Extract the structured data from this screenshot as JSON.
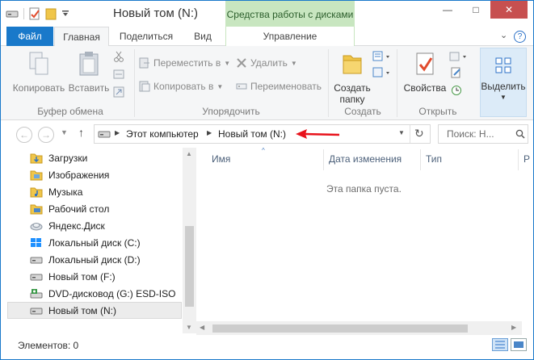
{
  "window": {
    "title": "Новый том (N:)",
    "context_tab_group": "Средства работы с дисками",
    "controls": {
      "minimize": "—",
      "maximize": "□",
      "close": "✕"
    }
  },
  "tabs": {
    "file": "Файл",
    "home": "Главная",
    "share": "Поделиться",
    "view": "Вид",
    "manage": "Управление"
  },
  "ribbon": {
    "clipboard": {
      "copy": "Копировать",
      "paste": "Вставить",
      "label": "Буфер обмена"
    },
    "organize": {
      "move_to": "Переместить в",
      "copy_to": "Копировать в",
      "delete": "Удалить",
      "rename": "Переименовать",
      "label": "Упорядочить"
    },
    "new": {
      "new_folder_line1": "Создать",
      "new_folder_line2": "папку",
      "label": "Создать"
    },
    "open": {
      "properties": "Свойства",
      "label": "Открыть"
    },
    "select": {
      "label": "Выделить"
    }
  },
  "address": {
    "crumbs": [
      "Этот компьютер",
      "Новый том (N:)"
    ],
    "search_placeholder": "Поиск: Н..."
  },
  "nav_pane": {
    "items": [
      {
        "label": "Загрузки",
        "icon": "downloads-folder-icon"
      },
      {
        "label": "Изображения",
        "icon": "pictures-folder-icon"
      },
      {
        "label": "Музыка",
        "icon": "music-folder-icon"
      },
      {
        "label": "Рабочий стол",
        "icon": "desktop-folder-icon"
      },
      {
        "label": "Яндекс.Диск",
        "icon": "yandex-disk-icon"
      },
      {
        "label": "Локальный диск (C:)",
        "icon": "windows-drive-icon"
      },
      {
        "label": "Локальный диск (D:)",
        "icon": "drive-icon"
      },
      {
        "label": "Новый том (F:)",
        "icon": "drive-icon"
      },
      {
        "label": "DVD-дисковод (G:) ESD-ISO",
        "icon": "dvd-drive-icon"
      },
      {
        "label": "Новый том (N:)",
        "icon": "drive-icon",
        "selected": true
      }
    ]
  },
  "content": {
    "columns": [
      "Имя",
      "Дата изменения",
      "Тип",
      "Р"
    ],
    "empty_message": "Эта папка пуста."
  },
  "status": {
    "items_count": "Элементов: 0"
  },
  "colors": {
    "accent": "#1979ca",
    "context_tab": "#c8e6c0",
    "annotation_arrow": "#e8121b"
  }
}
